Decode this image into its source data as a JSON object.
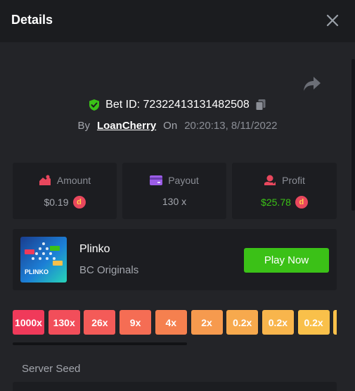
{
  "header": {
    "title": "Details"
  },
  "bet": {
    "id_label": "Bet ID: 7232241313148250",
    "id_suffix": "8",
    "by_label": "By",
    "user": "LoanCherry",
    "on_label": "On",
    "time": "20:20:13, 8/11/2022"
  },
  "stats": {
    "amount": {
      "label": "Amount",
      "value": "$0.19"
    },
    "payout": {
      "label": "Payout",
      "value": "130 x"
    },
    "profit": {
      "label": "Profit",
      "value": "$25.78"
    },
    "coin_symbol": "d"
  },
  "game": {
    "name": "Plinko",
    "provider": "BC Originals",
    "play_label": "Play Now",
    "thumb_text": "PLINKO"
  },
  "multipliers": [
    "1000x",
    "130x",
    "26x",
    "9x",
    "4x",
    "2x",
    "0.2x",
    "0.2x",
    "0.2x",
    ""
  ],
  "multiplier_colors": [
    "#f03a5a",
    "#f24e5a",
    "#f45b58",
    "#f56d54",
    "#f5804f",
    "#f69a4e",
    "#f7a94d",
    "#f8b54c",
    "#f9c04a",
    "#f9c04a"
  ],
  "seed": {
    "label": "Server Seed"
  },
  "colors": {
    "green": "#3bc117",
    "coin": "#e8475d"
  }
}
